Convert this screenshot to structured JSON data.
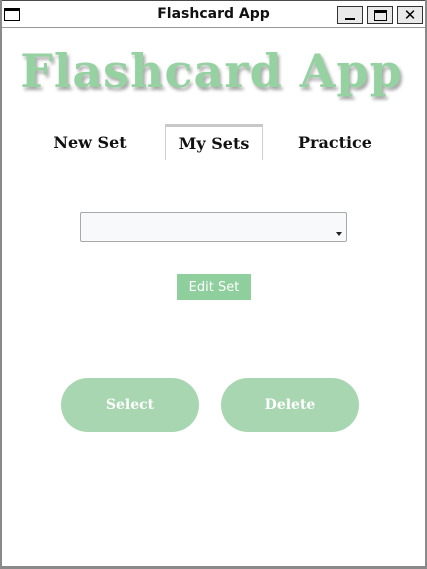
{
  "window": {
    "title": "Flashcard App",
    "controls": {
      "minimize": "_",
      "maximize": "□",
      "close": "✕"
    }
  },
  "app": {
    "heading": "Flashcard App",
    "accent_color": "#96d1a2"
  },
  "tabs": [
    {
      "label": "New Set",
      "selected": false
    },
    {
      "label": "My Sets",
      "selected": true
    },
    {
      "label": "Practice",
      "selected": false
    }
  ],
  "my_sets": {
    "set_dropdown": {
      "value": "",
      "icon": "chevron-down-icon"
    },
    "edit_label": "Edit Set",
    "select_label": "Select",
    "delete_label": "Delete"
  }
}
